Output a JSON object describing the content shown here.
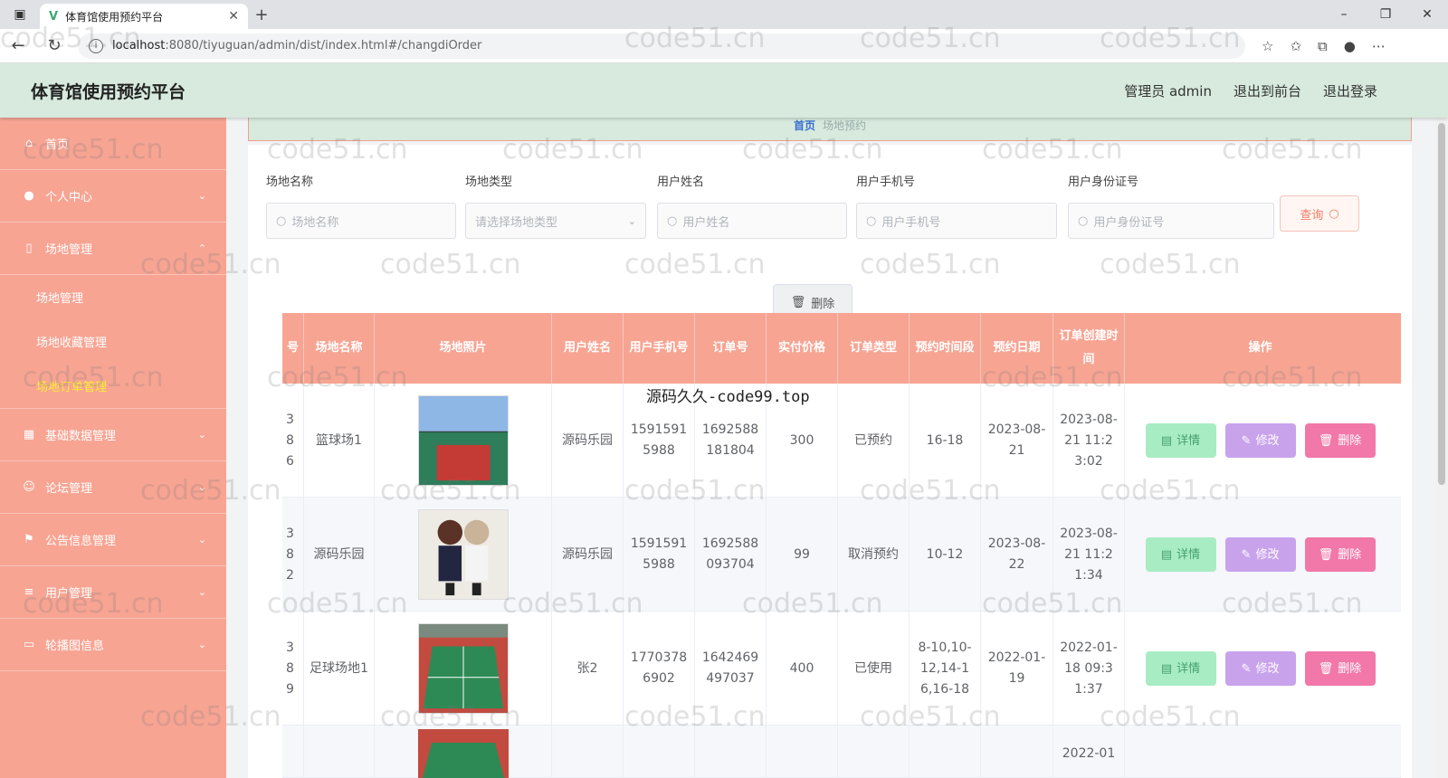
{
  "browser": {
    "tab_title": "体育馆使用预约平台",
    "url_host": "localhost",
    "url_path": ":8080/tiyuguan/admin/dist/index.html#/changdiOrder"
  },
  "header": {
    "title": "体育馆使用预约平台",
    "admin_label": "管理员 admin",
    "front_link": "退出到前台",
    "logout_link": "退出登录"
  },
  "sidebar": {
    "items": [
      {
        "label": "首页",
        "icon": "home-icon"
      },
      {
        "label": "个人中心",
        "icon": "user-icon"
      },
      {
        "label": "场地管理",
        "icon": "phone-icon"
      },
      {
        "label": "基础数据管理",
        "icon": "grid-icon"
      },
      {
        "label": "论坛管理",
        "icon": "forum-icon"
      },
      {
        "label": "公告信息管理",
        "icon": "flag-icon"
      },
      {
        "label": "用户管理",
        "icon": "list-icon"
      },
      {
        "label": "轮播图信息",
        "icon": "image-icon"
      }
    ],
    "sub_items": [
      "场地管理",
      "场地收藏管理",
      "场地订单管理"
    ]
  },
  "breadcrumb": {
    "home": "首页",
    "current": "场地预约"
  },
  "search": {
    "fields": [
      {
        "label": "场地名称",
        "placeholder": "场地名称"
      },
      {
        "label": "场地类型",
        "placeholder": "请选择场地类型"
      },
      {
        "label": "用户姓名",
        "placeholder": "用户姓名"
      },
      {
        "label": "用户手机号",
        "placeholder": "用户手机号"
      },
      {
        "label": "用户身份证号",
        "placeholder": "用户身份证号"
      }
    ],
    "query_label": "查询",
    "delete_label": "删除"
  },
  "table": {
    "headers": [
      "号",
      "场地名称",
      "场地照片",
      "用户姓名",
      "用户手机号",
      "订单号",
      "实付价格",
      "订单类型",
      "预约时间段",
      "预约日期",
      "订单创建时间",
      "操作"
    ],
    "rows": [
      {
        "id": "38 6",
        "name": "篮球场1",
        "user": "源码乐园",
        "phone": "15915915988",
        "order": "1692588181804",
        "price": "300",
        "type": "已预约",
        "slot": "16-18",
        "date": "2023-08-21",
        "created": "2023-08-21 11:23:02"
      },
      {
        "id": "38 2",
        "name": "源码乐园",
        "user": "源码乐园",
        "phone": "15915915988",
        "order": "1692588093704",
        "price": "99",
        "type": "取消预约",
        "slot": "10-12",
        "date": "2023-08-22",
        "created": "2023-08-21 11:21:34"
      },
      {
        "id": "38 9",
        "name": "足球场地1",
        "user": "张2",
        "phone": "17703786902",
        "order": "1642469497037",
        "price": "400",
        "type": "已使用",
        "slot": "8-10,10-12,14-16,16-18",
        "date": "2022-01-19",
        "created": "2022-01-18 09:31:37"
      },
      {
        "id": "",
        "name": "",
        "user": "",
        "phone": "",
        "order": "",
        "price": "",
        "type": "",
        "slot": "",
        "date": "",
        "created": "2022-01"
      }
    ],
    "actions": {
      "detail": "详情",
      "edit": "修改",
      "delete": "删除"
    }
  },
  "watermark": "code51.cn",
  "overlay_text": "源码久久-code99.top"
}
